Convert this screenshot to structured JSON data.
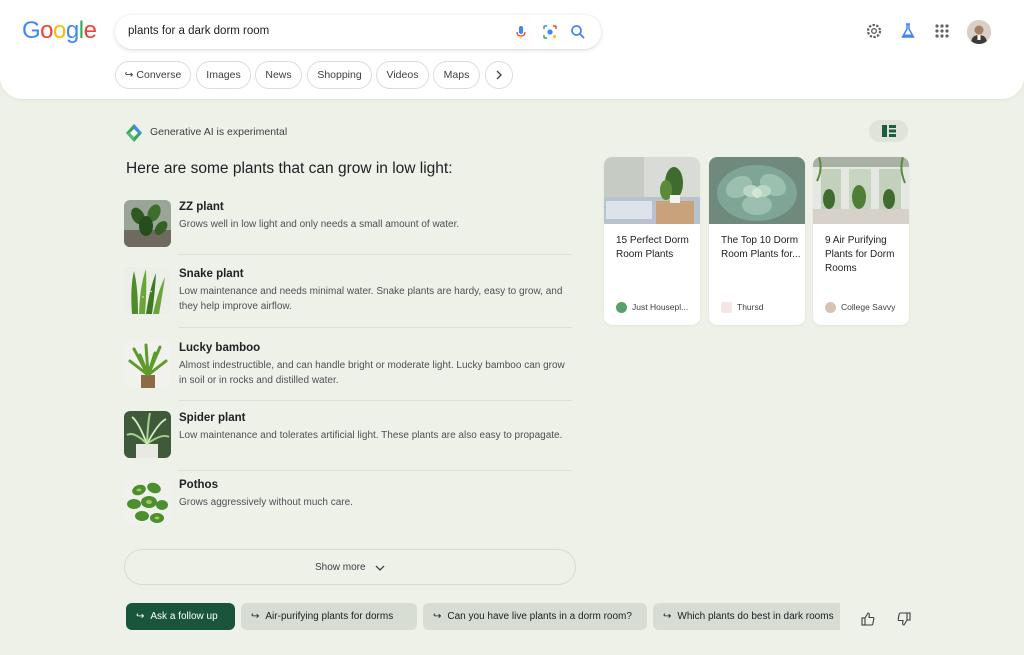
{
  "header": {
    "logo_text": "Google",
    "search_value": "plants for a dark dorm room",
    "filter_chips": [
      "Converse",
      "Images",
      "News",
      "Shopping",
      "Videos",
      "Maps"
    ]
  },
  "ai_overview": {
    "badge": "Generative AI is experimental",
    "heading": "Here are some plants that can grow in low light:",
    "items": [
      {
        "title": "ZZ plant",
        "desc": "Grows well in low light and only needs a small amount of water."
      },
      {
        "title": "Snake plant",
        "desc": "Low maintenance and needs minimal water. Snake plants are hardy, easy to grow, and they help improve airflow."
      },
      {
        "title": "Lucky bamboo",
        "desc": "Almost indestructible, and can handle bright or moderate light. Lucky bamboo can grow in soil or in rocks and distilled water."
      },
      {
        "title": "Spider plant",
        "desc": "Low maintenance and tolerates artificial light. These plants are also easy to propagate."
      },
      {
        "title": "Pothos",
        "desc": "Grows aggressively without much care."
      }
    ],
    "show_more": "Show more"
  },
  "sources": [
    {
      "title": "15 Perfect Dorm Room Plants",
      "site": "Just Housepl..."
    },
    {
      "title": "The Top 10 Dorm Room Plants for...",
      "site": "Thursd"
    },
    {
      "title": "9 Air Purifying Plants for Dorm Rooms",
      "site": "College Savvy"
    }
  ],
  "follow_up": {
    "primary": "Ask a follow up",
    "suggestions": [
      "Air-purifying plants for dorms",
      "Can you have live plants in a dorm room?",
      "Which plants do best in dark rooms"
    ]
  },
  "colors": {
    "page_bg": "#eef1e8",
    "follow_up_primary": "#19553b",
    "suggestion_bg": "#d7ddd2"
  }
}
